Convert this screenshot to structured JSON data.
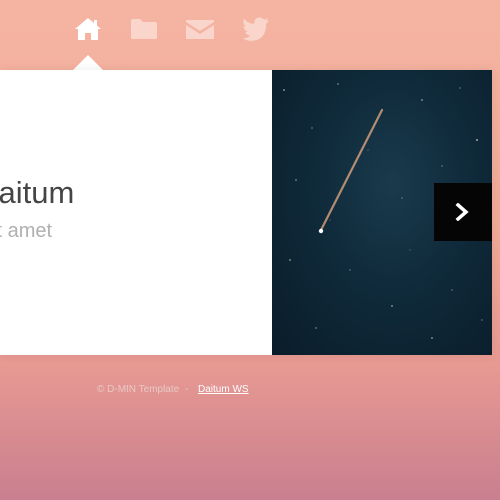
{
  "nav": {
    "items": [
      {
        "icon": "home-icon",
        "active": true
      },
      {
        "icon": "folder-icon",
        "active": false
      },
      {
        "icon": "mail-icon",
        "active": false
      },
      {
        "icon": "twitter-icon",
        "active": false
      }
    ]
  },
  "slide": {
    "title": "y Daitum",
    "subtitle": "dolor sit amet",
    "image": "shooting-star-night-sky",
    "next_icon": "chevron-right-icon"
  },
  "footer": {
    "copyright": "© D-MIN Template",
    "separator": "-",
    "link_label": "Daitum WS"
  },
  "colors": {
    "background_top": "#f5b4a2",
    "background_bottom": "#c97f8f",
    "title": "#454545",
    "subtitle": "#b0b0b0",
    "next_button": "#050505"
  }
}
